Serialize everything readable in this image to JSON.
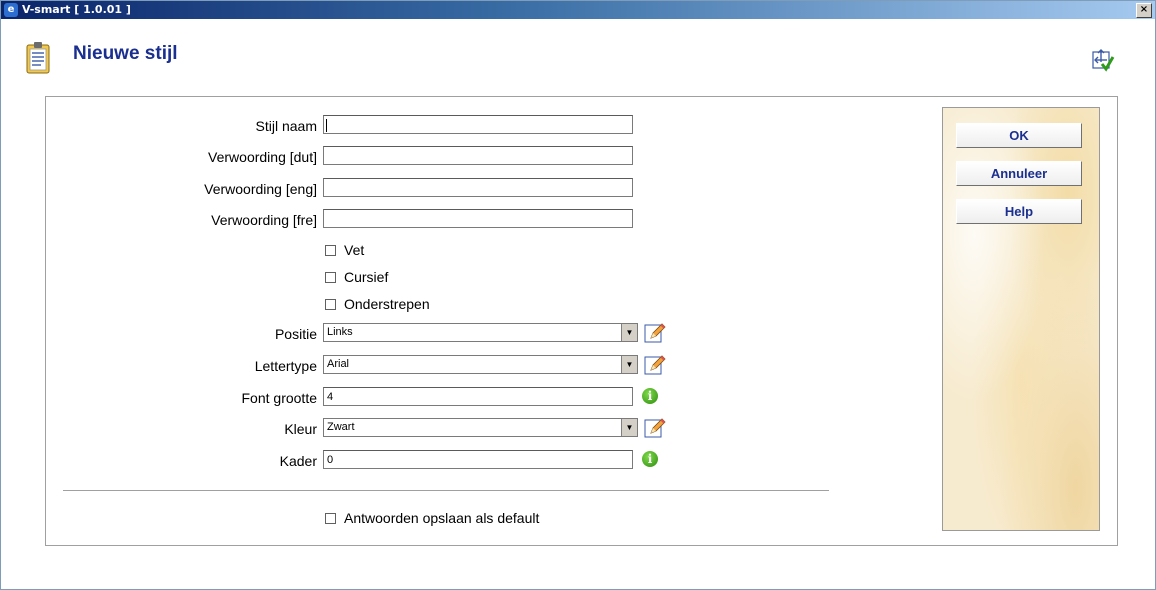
{
  "window": {
    "title": "V-smart [ 1.0.01 ]",
    "close_glyph": "×"
  },
  "header": {
    "title": "Nieuwe stijl",
    "icon": "clipboard-list-icon",
    "corner_icon": "submit-check-icon"
  },
  "form": {
    "style_name_label": "Stijl naam",
    "style_name_value": "",
    "wording_dut_label": "Verwoording [dut]",
    "wording_dut_value": "",
    "wording_eng_label": "Verwoording [eng]",
    "wording_eng_value": "",
    "wording_fre_label": "Verwoording [fre]",
    "wording_fre_value": "",
    "bold_label": "Vet",
    "italic_label": "Cursief",
    "underline_label": "Onderstrepen",
    "position_label": "Positie",
    "position_value": "Links",
    "font_label": "Lettertype",
    "font_value": "Arial",
    "font_size_label": "Font grootte",
    "font_size_value": "4",
    "color_label": "Kleur",
    "color_value": "Zwart",
    "frame_label": "Kader",
    "frame_value": "0",
    "save_default_label": "Antwoorden opslaan als default"
  },
  "buttons": {
    "ok": "OK",
    "cancel": "Annuleer",
    "help": "Help"
  },
  "colors": {
    "title_blue": "#1a2f8f",
    "info_green": "#2e8b0f"
  }
}
